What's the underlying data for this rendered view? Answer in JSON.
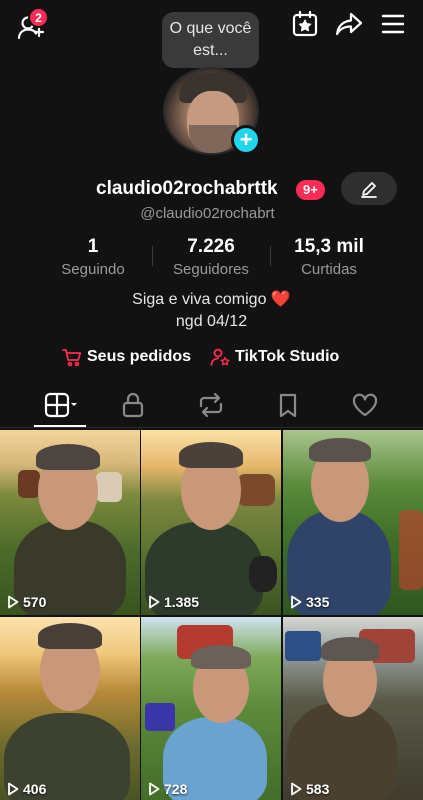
{
  "header": {
    "notification_count": "2"
  },
  "profile": {
    "bubble_text": "O que você est...",
    "username": "claudio02rochabrttk",
    "message_badge": "9+",
    "handle": "@claudio02rochabrt"
  },
  "stats": [
    {
      "value": "1",
      "label": "Seguindo"
    },
    {
      "value": "7.226",
      "label": "Seguidores"
    },
    {
      "value": "15,3 mil",
      "label": "Curtidas"
    }
  ],
  "bio": {
    "line1": "Siga e viva comigo ❤️",
    "line2": "ngd 04/12"
  },
  "links": {
    "orders": "Seus pedidos",
    "studio": "TikTok Studio"
  },
  "videos": [
    {
      "views": "570"
    },
    {
      "views": "1.385"
    },
    {
      "views": "335"
    },
    {
      "views": "406"
    },
    {
      "views": "728"
    },
    {
      "views": "583"
    }
  ],
  "colors": {
    "accent": "#fe2c55",
    "plus": "#20d5ec",
    "background": "#121212"
  }
}
